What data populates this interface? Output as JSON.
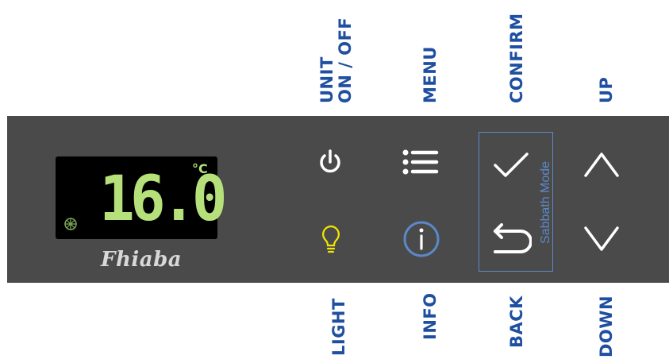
{
  "labels": {
    "unit": "UNIT\nON / OFF",
    "menu": "MENU",
    "confirm": "CONFIRM",
    "up": "UP",
    "light": "LIGHT",
    "info": "INFO",
    "back": "BACK",
    "down": "DOWN"
  },
  "display": {
    "temperature": "16.0",
    "unit": "°C"
  },
  "brand": "Fhiaba",
  "sabbath_mode": "Sabbath Mode",
  "colors": {
    "label": "#1f4fa0",
    "panel": "#4a4a4a",
    "lcd": "#b5e07a",
    "light_icon": "#f2e600",
    "info_icon": "#5b88c8",
    "sabbath": "#5b88c8"
  },
  "icons": [
    "power-icon",
    "menu-list-icon",
    "check-icon",
    "chevron-up-icon",
    "lightbulb-icon",
    "info-icon",
    "back-arrow-icon",
    "chevron-down-icon"
  ]
}
